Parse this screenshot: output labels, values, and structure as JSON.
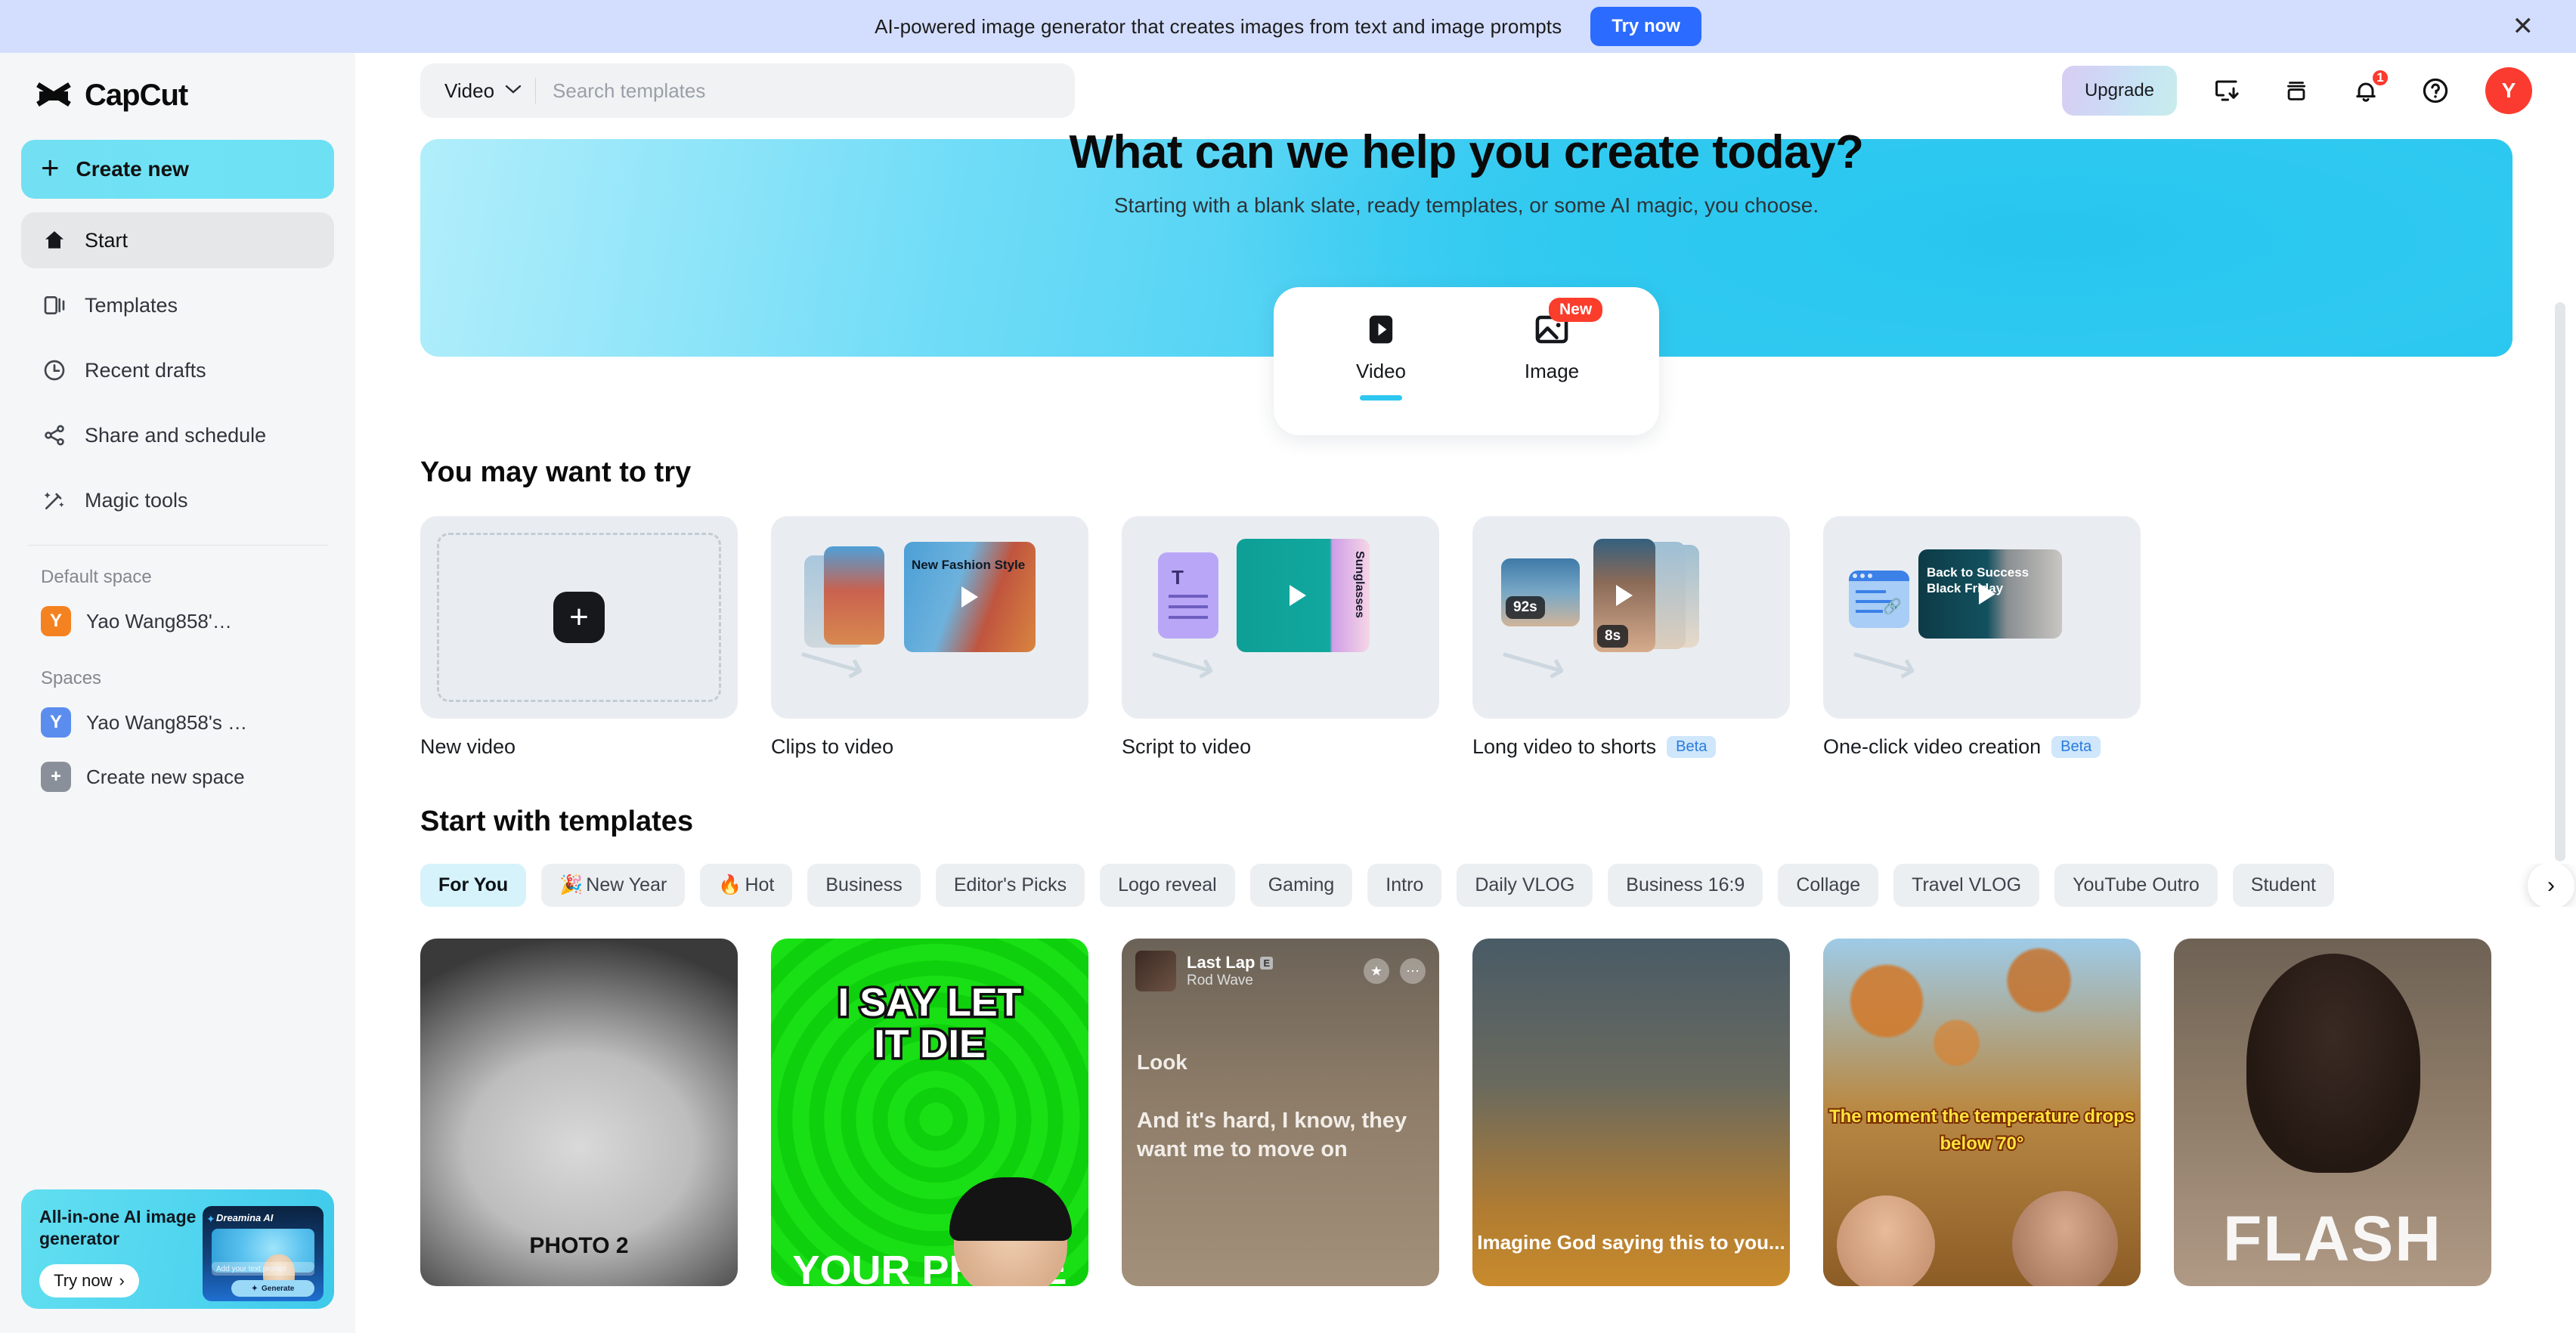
{
  "promo_banner": {
    "text": "AI-powered image generator that creates images from text and image prompts",
    "button": "Try now",
    "close_icon": "close-icon",
    "bg_color": "#d3deff",
    "button_color": "#2b6bff"
  },
  "sidebar": {
    "brand": "CapCut",
    "create_new": "Create new",
    "nav_items": [
      {
        "label": "Start",
        "icon": "home-icon",
        "active": true
      },
      {
        "label": "Templates",
        "icon": "templates-icon",
        "active": false
      },
      {
        "label": "Recent drafts",
        "icon": "clock-icon",
        "active": false
      },
      {
        "label": "Share and schedule",
        "icon": "share-icon",
        "active": false
      },
      {
        "label": "Magic tools",
        "icon": "magic-wand-icon",
        "active": false
      }
    ],
    "default_space_label": "Default space",
    "default_space": {
      "initial": "Y",
      "name": "Yao Wang858'…",
      "color": "#f58220"
    },
    "spaces_label": "Spaces",
    "spaces": [
      {
        "initial": "Y",
        "name": "Yao Wang858's …",
        "color": "#5b8def"
      },
      {
        "initial": "+",
        "name": "Create new space",
        "color": "#8a9099"
      }
    ],
    "promo": {
      "title": "All-in-one AI image generator",
      "button": "Try now",
      "brand": "Dreamina AI",
      "prompt_placeholder": "Add your text prompt",
      "generate": "Generate"
    }
  },
  "topbar": {
    "search_category": "Video",
    "search_placeholder": "Search templates",
    "search_value": "",
    "upgrade_label": "Upgrade",
    "icons": [
      {
        "name": "download-app-icon"
      },
      {
        "name": "archive-box-icon"
      },
      {
        "name": "bell-icon",
        "badge": "1"
      },
      {
        "name": "help-circle-icon"
      }
    ],
    "avatar": {
      "initial": "Y",
      "color": "#fb3b2f"
    }
  },
  "hero": {
    "title": "What can we help you create today?",
    "subtitle": "Starting with a blank slate, ready templates, or some AI magic, you choose.",
    "modes": [
      {
        "label": "Video",
        "icon": "video-play-icon",
        "active": true,
        "badge": ""
      },
      {
        "label": "Image",
        "icon": "image-icon",
        "active": false,
        "badge": "New"
      }
    ]
  },
  "sections": {
    "try_title": "You may want to try",
    "templates_title": "Start with templates"
  },
  "try_cards": [
    {
      "label": "New video",
      "badge": "",
      "icon": "plus-icon",
      "kind": "new"
    },
    {
      "label": "Clips to video",
      "badge": "",
      "kind": "clips",
      "thumb_text": "New Fashion Style"
    },
    {
      "label": "Script to video",
      "badge": "",
      "kind": "script",
      "thumb_text": "Sunglasses"
    },
    {
      "label": "Long video to shorts",
      "badge": "Beta",
      "kind": "shorts",
      "duration_in": "92s",
      "duration_out": "8s"
    },
    {
      "label": "One-click video creation",
      "badge": "Beta",
      "kind": "oneclick",
      "thumb_text": "Back to Success Black Friday"
    }
  ],
  "category_chips": [
    {
      "label": "For You",
      "emoji": "",
      "active": true
    },
    {
      "label": "New Year",
      "emoji": "🎉",
      "active": false
    },
    {
      "label": "Hot",
      "emoji": "🔥",
      "active": false
    },
    {
      "label": "Business",
      "emoji": "",
      "active": false
    },
    {
      "label": "Editor's Picks",
      "emoji": "",
      "active": false
    },
    {
      "label": "Logo reveal",
      "emoji": "",
      "active": false
    },
    {
      "label": "Gaming",
      "emoji": "",
      "active": false
    },
    {
      "label": "Intro",
      "emoji": "",
      "active": false
    },
    {
      "label": "Daily VLOG",
      "emoji": "",
      "active": false
    },
    {
      "label": "Business 16:9",
      "emoji": "",
      "active": false
    },
    {
      "label": "Collage",
      "emoji": "",
      "active": false
    },
    {
      "label": "Travel VLOG",
      "emoji": "",
      "active": false
    },
    {
      "label": "YouTube Outro",
      "emoji": "",
      "active": false
    },
    {
      "label": "Student",
      "emoji": "",
      "active": false
    }
  ],
  "chips_next_icon": "chevron-right-icon",
  "template_cards": [
    {
      "caption": "PHOTO 2",
      "style": "t1"
    },
    {
      "line1": "I SAY LET",
      "line2": "IT DIE",
      "line3": "YOUR PHONE",
      "style": "t2"
    },
    {
      "song": "Last Lap",
      "artist": "Rod Wave",
      "explicit": "E",
      "lyric1": "Look",
      "lyric2": "And it's hard, I know, they want me to move on",
      "style": "t3"
    },
    {
      "caption2": "Imagine God saying this to you...",
      "style": "t4"
    },
    {
      "caption3": "The moment the temperature drops below 70°",
      "style": "t5"
    },
    {
      "caption4": "FLASH",
      "style": "t6"
    }
  ]
}
